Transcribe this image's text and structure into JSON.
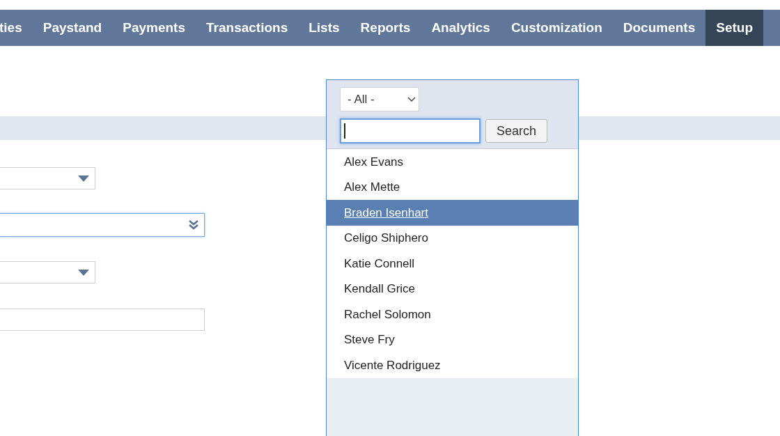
{
  "nav": [
    {
      "label": "ties",
      "selected": false
    },
    {
      "label": "Paystand",
      "selected": false
    },
    {
      "label": "Payments",
      "selected": false
    },
    {
      "label": "Transactions",
      "selected": false
    },
    {
      "label": "Lists",
      "selected": false
    },
    {
      "label": "Reports",
      "selected": false
    },
    {
      "label": "Analytics",
      "selected": false
    },
    {
      "label": "Customization",
      "selected": false
    },
    {
      "label": "Documents",
      "selected": false
    },
    {
      "label": "Setup",
      "selected": true
    }
  ],
  "form_fields": [
    {
      "kind": "select",
      "focused": false
    },
    {
      "kind": "multiselect",
      "focused": true
    },
    {
      "kind": "select",
      "focused": false
    },
    {
      "kind": "text",
      "focused": false
    }
  ],
  "popup": {
    "filter": {
      "value": "- All -"
    },
    "search_field": {
      "focused": true
    },
    "search_button": "Search",
    "items": [
      {
        "label": "Alex Evans",
        "selected": false
      },
      {
        "label": "Alex Mette",
        "selected": false
      },
      {
        "label": "Braden Isenhart",
        "selected": true
      },
      {
        "label": "Celigo Shiphero",
        "selected": false
      },
      {
        "label": "Katie Connell",
        "selected": false
      },
      {
        "label": "Kendall Grice",
        "selected": false
      },
      {
        "label": "Rachel Solomon",
        "selected": false
      },
      {
        "label": "Steve Fry",
        "selected": false
      },
      {
        "label": "Vicente Rodriguez",
        "selected": false
      }
    ]
  }
}
